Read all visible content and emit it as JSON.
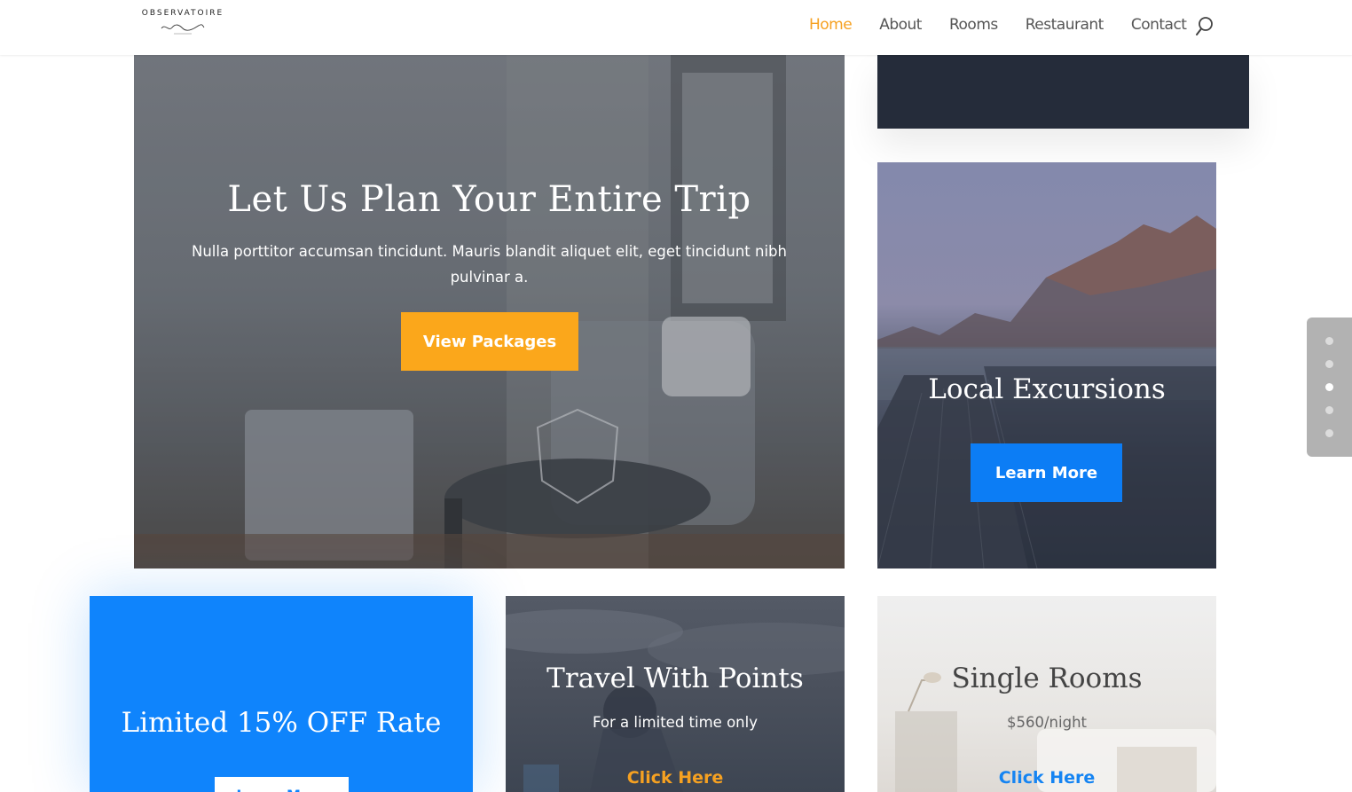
{
  "header": {
    "logo_text": "OBSERVATOIRE",
    "nav": [
      {
        "label": "Home",
        "active": true
      },
      {
        "label": "About",
        "active": false
      },
      {
        "label": "Rooms",
        "active": false
      },
      {
        "label": "Restaurant",
        "active": false
      },
      {
        "label": "Contact",
        "active": false
      }
    ],
    "search_icon": "search-icon",
    "accent_color": "#f6a121"
  },
  "hero": {
    "title": "Let Us Plan Your Entire Trip",
    "text": "Nulla porttitor accumsan tincidunt. Mauris blandit aliquet elit, eget tincidunt nibh pulvinar a.",
    "button_label": "View Packages",
    "button_color": "#fba71b"
  },
  "excursions": {
    "title": "Local Excursions",
    "button_label": "Learn More",
    "button_color": "#0c7df5"
  },
  "offer": {
    "title": "Limited 15% OFF Rate",
    "button_label": "Learn More",
    "background_color": "#0f84fc"
  },
  "points": {
    "title": "Travel With Points",
    "text": "For a limited time only",
    "link_label": "Click Here"
  },
  "single_rooms": {
    "title": "Single Rooms",
    "price": "$560/night",
    "link_label": "Click Here"
  },
  "dot_nav": {
    "count": 5,
    "active_index": 2
  }
}
